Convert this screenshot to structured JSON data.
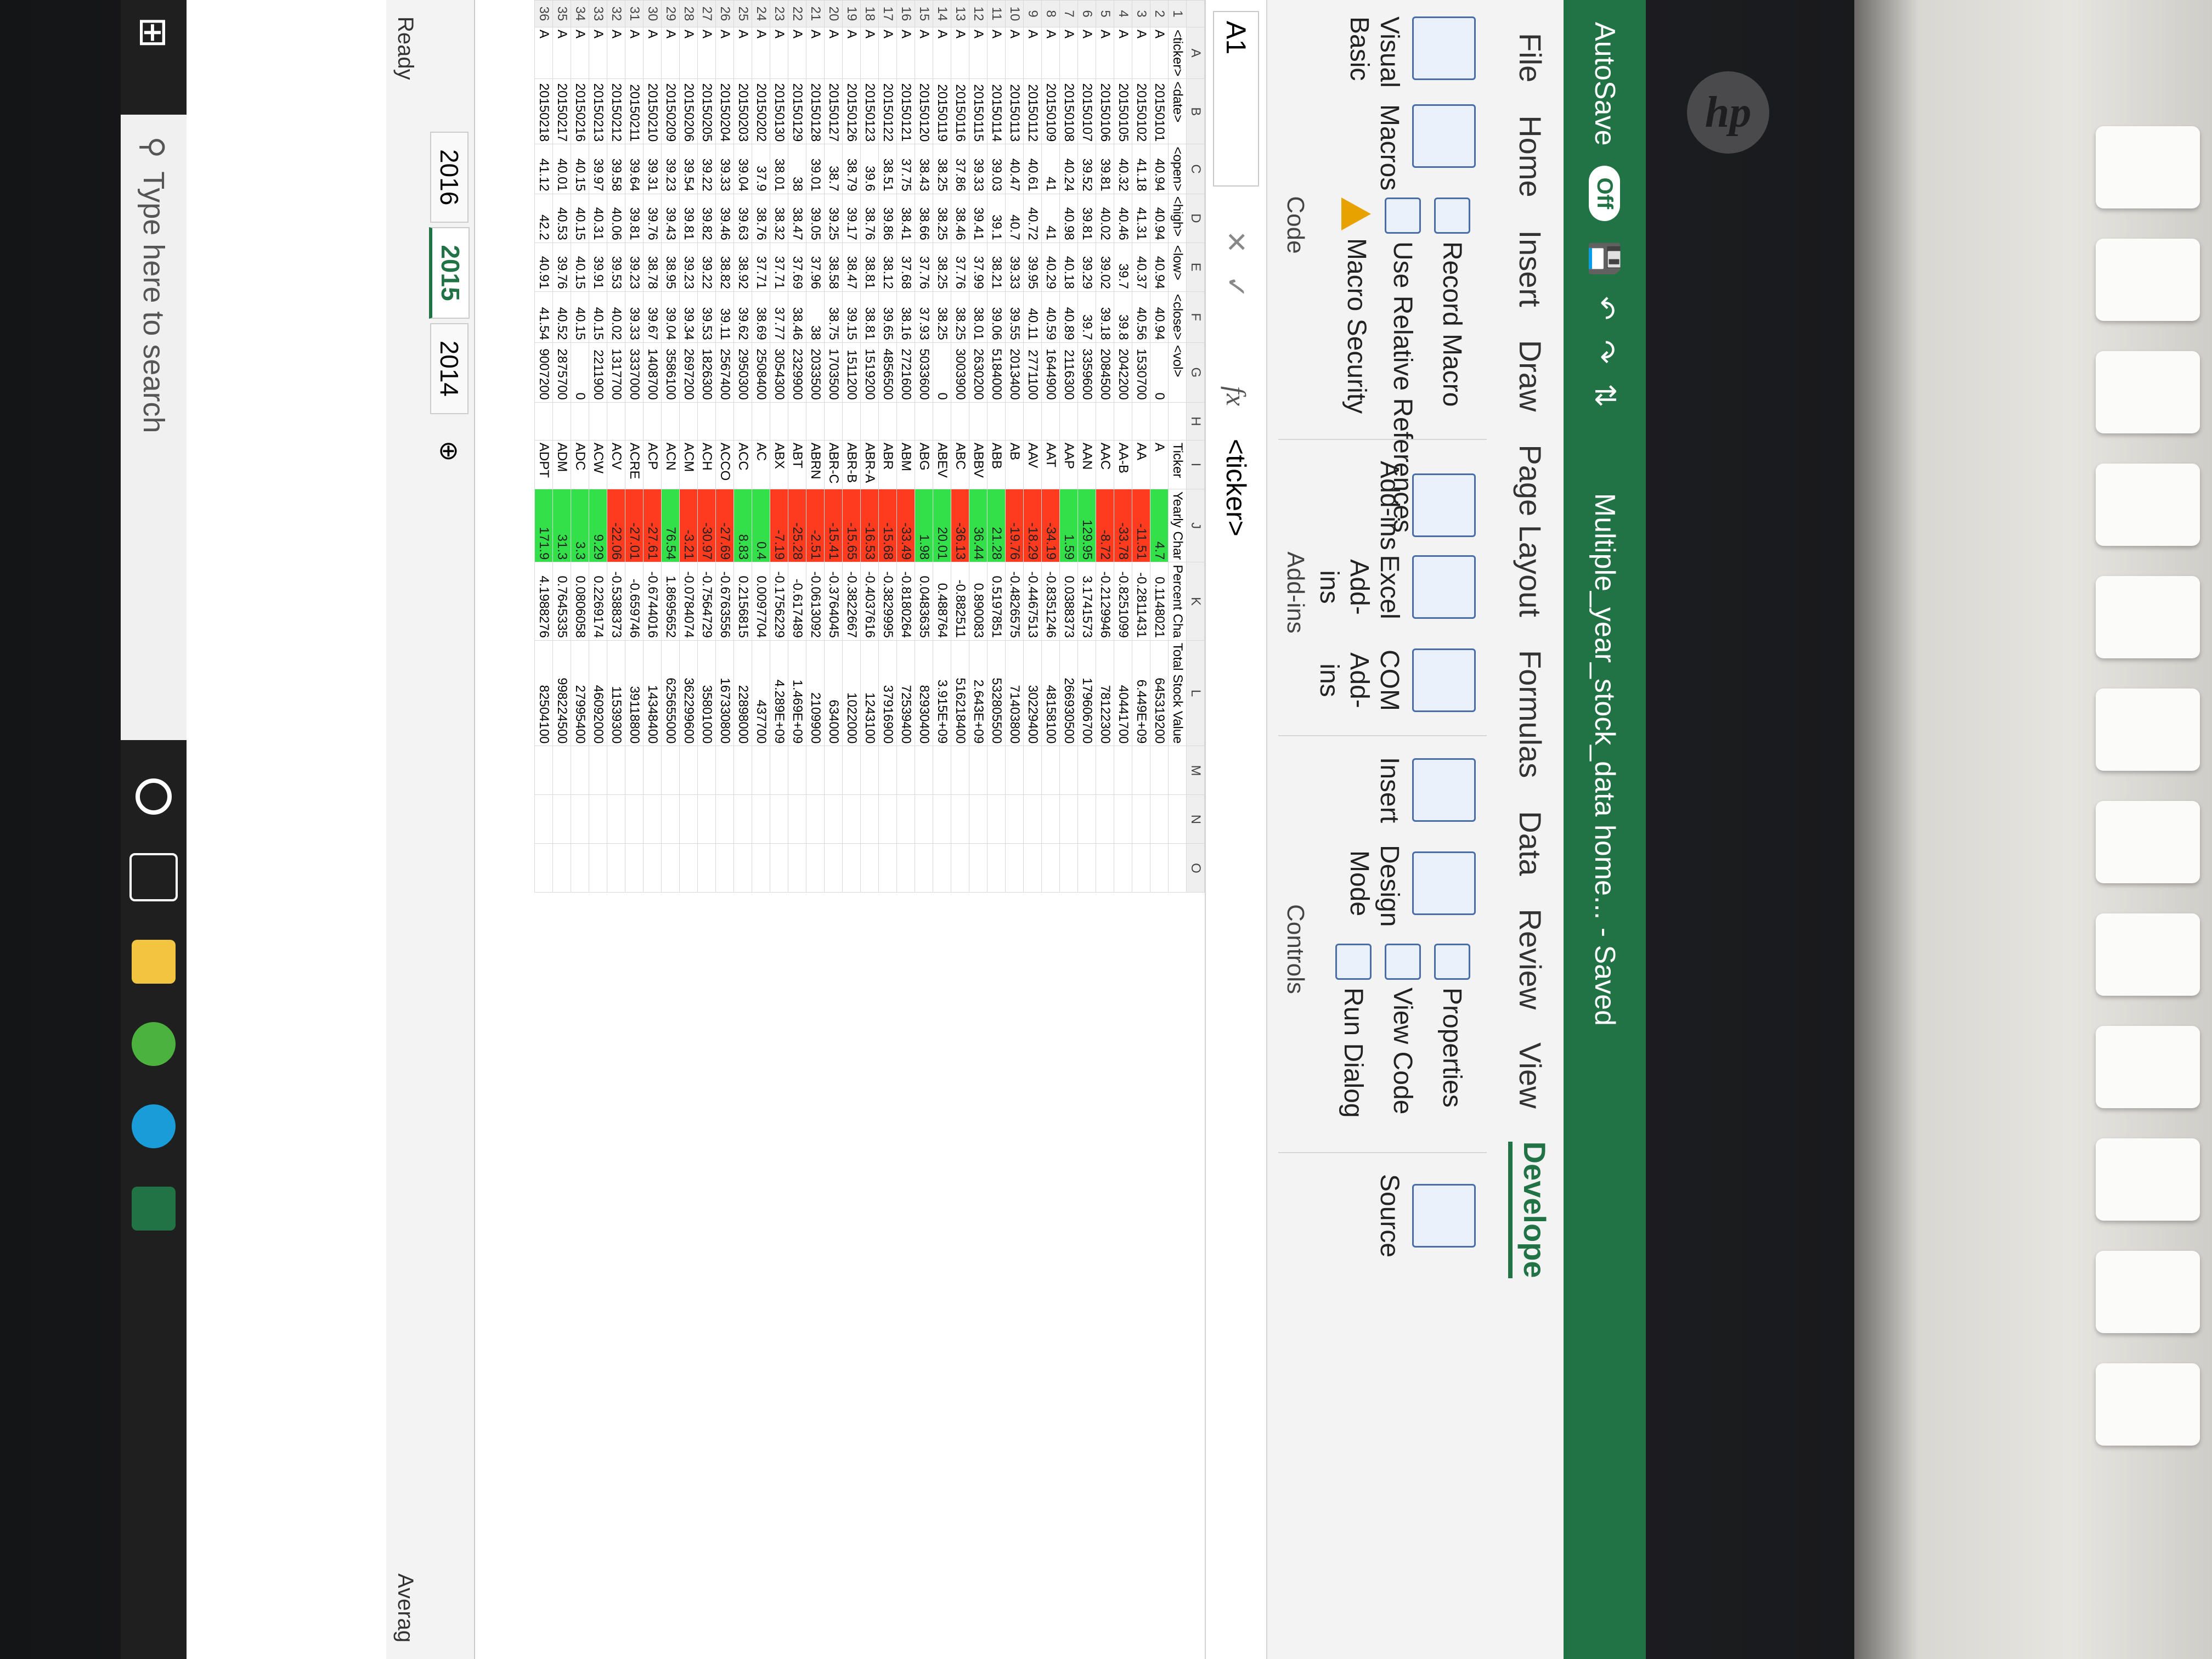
{
  "window": {
    "autosave_label": "AutoSave",
    "autosave_state": "Off",
    "title": "Multiple_year_stock_data home... - Saved"
  },
  "tabs": [
    "File",
    "Home",
    "Insert",
    "Draw",
    "Page Layout",
    "Formulas",
    "Data",
    "Review",
    "View",
    "Develope"
  ],
  "active_tab": "Develope",
  "ribbon": {
    "code": {
      "visual_basic": "Visual Basic",
      "macros": "Macros",
      "record_macro": "Record Macro",
      "use_relative": "Use Relative References",
      "macro_security": "Macro Security",
      "label": "Code"
    },
    "addins": {
      "add_ins": "Add-ins",
      "excel_add_ins": "Excel Add-ins",
      "com_add_ins": "COM Add-ins",
      "label": "Add-ins"
    },
    "controls": {
      "insert": "Insert",
      "design_mode": "Design Mode",
      "properties": "Properties",
      "view_code": "View Code",
      "run_dialog": "Run Dialog",
      "label": "Controls"
    },
    "xml": {
      "source": "Source"
    }
  },
  "formula_bar": {
    "name_box": "A1",
    "fx": "fx",
    "value": "<ticker>"
  },
  "columns": [
    "A",
    "B",
    "C",
    "D",
    "E",
    "F",
    "G",
    "H",
    "I",
    "J",
    "K",
    "L",
    "M",
    "N",
    "O"
  ],
  "left_headers": [
    "<ticker>",
    "<date>",
    "<open>",
    "<high>",
    "<low>",
    "<close>",
    "<vol>"
  ],
  "left_rows": [
    [
      "A",
      "20150101",
      "40.94",
      "40.94",
      "40.94",
      "40.94",
      "0"
    ],
    [
      "A",
      "20150102",
      "41.18",
      "41.31",
      "40.37",
      "40.56",
      "1530700"
    ],
    [
      "A",
      "20150105",
      "40.32",
      "40.46",
      "39.7",
      "39.8",
      "2042200"
    ],
    [
      "A",
      "20150106",
      "39.81",
      "40.02",
      "39.02",
      "39.18",
      "2084500"
    ],
    [
      "A",
      "20150107",
      "39.52",
      "39.81",
      "39.29",
      "39.7",
      "3359600"
    ],
    [
      "A",
      "20150108",
      "40.24",
      "40.98",
      "40.18",
      "40.89",
      "2116300"
    ],
    [
      "A",
      "20150109",
      "41",
      "41",
      "40.29",
      "40.59",
      "1644900"
    ],
    [
      "A",
      "20150112",
      "40.61",
      "40.72",
      "39.95",
      "40.11",
      "2771100"
    ],
    [
      "A",
      "20150113",
      "40.47",
      "40.7",
      "39.33",
      "39.55",
      "2013400"
    ],
    [
      "A",
      "20150114",
      "39.03",
      "39.1",
      "38.21",
      "39.06",
      "5184000"
    ],
    [
      "A",
      "20150115",
      "39.33",
      "39.41",
      "37.99",
      "38.01",
      "2630200"
    ],
    [
      "A",
      "20150116",
      "37.86",
      "38.46",
      "37.76",
      "38.25",
      "3003900"
    ],
    [
      "A",
      "20150119",
      "38.25",
      "38.25",
      "38.25",
      "38.25",
      "0"
    ],
    [
      "A",
      "20150120",
      "38.43",
      "38.66",
      "37.76",
      "37.93",
      "5033600"
    ],
    [
      "A",
      "20150121",
      "37.75",
      "38.41",
      "37.68",
      "38.16",
      "2721600"
    ],
    [
      "A",
      "20150122",
      "38.51",
      "39.86",
      "38.12",
      "39.65",
      "4856500"
    ],
    [
      "A",
      "20150123",
      "39.6",
      "38.76",
      "38.81",
      "38.81",
      "1519200"
    ],
    [
      "A",
      "20150126",
      "38.79",
      "39.17",
      "38.47",
      "39.15",
      "1511200"
    ],
    [
      "A",
      "20150127",
      "38.7",
      "39.25",
      "38.58",
      "38.75",
      "1703500"
    ],
    [
      "A",
      "20150128",
      "39.01",
      "39.05",
      "37.96",
      "38",
      "2033500"
    ],
    [
      "A",
      "20150129",
      "38",
      "38.47",
      "37.69",
      "38.46",
      "2329900"
    ],
    [
      "A",
      "20150130",
      "38.01",
      "38.32",
      "37.71",
      "37.77",
      "3054300"
    ],
    [
      "A",
      "20150202",
      "37.9",
      "38.76",
      "37.71",
      "38.69",
      "2508400"
    ],
    [
      "A",
      "20150203",
      "39.04",
      "39.63",
      "38.92",
      "39.62",
      "2950300"
    ],
    [
      "A",
      "20150204",
      "39.33",
      "39.46",
      "38.82",
      "39.11",
      "2567400"
    ],
    [
      "A",
      "20150205",
      "39.22",
      "39.82",
      "39.22",
      "39.53",
      "1826300"
    ],
    [
      "A",
      "20150206",
      "39.54",
      "39.81",
      "39.23",
      "39.34",
      "2697200"
    ],
    [
      "A",
      "20150209",
      "39.23",
      "39.43",
      "38.95",
      "39.04",
      "3586100"
    ],
    [
      "A",
      "20150210",
      "39.31",
      "39.76",
      "38.78",
      "39.67",
      "1408700"
    ],
    [
      "A",
      "20150211",
      "39.64",
      "39.81",
      "39.23",
      "39.33",
      "3337000"
    ],
    [
      "A",
      "20150212",
      "39.58",
      "40.06",
      "39.53",
      "40.02",
      "1317700"
    ],
    [
      "A",
      "20150213",
      "39.97",
      "40.31",
      "39.91",
      "40.15",
      "2211900"
    ],
    [
      "A",
      "20150216",
      "40.15",
      "40.15",
      "40.15",
      "40.15",
      "0"
    ],
    [
      "A",
      "20150217",
      "40.01",
      "40.53",
      "39.76",
      "40.52",
      "2875700"
    ],
    [
      "A",
      "20150218",
      "41.12",
      "42.2",
      "40.91",
      "41.54",
      "9007200"
    ]
  ],
  "right_headers": [
    "Ticker",
    "Yearly Char",
    "Percent Cha",
    "Total Stock Value"
  ],
  "right_rows": [
    [
      "A",
      "4.7",
      "0.1148021",
      "645319200",
      "green"
    ],
    [
      "AA",
      "-11.51",
      "-0.2811431",
      "6.449E+09",
      "red"
    ],
    [
      "AA-B",
      "-33.78",
      "-0.8251099",
      "40441700",
      "red"
    ],
    [
      "AAC",
      "-8.72",
      "-0.2129946",
      "78122300",
      "red"
    ],
    [
      "AAN",
      "129.95",
      "3.1741573",
      "179606700",
      "green"
    ],
    [
      "AAP",
      "1.59",
      "0.0388373",
      "266930500",
      "green"
    ],
    [
      "AAT",
      "-34.19",
      "-0.8351246",
      "48158100",
      "red"
    ],
    [
      "AAV",
      "-18.29",
      "-0.4467513",
      "30229400",
      "red"
    ],
    [
      "AB",
      "-19.76",
      "-0.4826575",
      "71403800",
      "red"
    ],
    [
      "ABB",
      "21.28",
      "0.5197851",
      "532805500",
      "green"
    ],
    [
      "ABBV",
      "36.44",
      "0.890083",
      "2.643E+09",
      "green"
    ],
    [
      "ABC",
      "-36.13",
      "-0.882511",
      "516218400",
      "red"
    ],
    [
      "ABEV",
      "20.01",
      "0.488764",
      "3.915E+09",
      "green"
    ],
    [
      "ABG",
      "1.98",
      "0.0483635",
      "82930400",
      "green"
    ],
    [
      "ABM",
      "-33.49",
      "-0.8180264",
      "72539400",
      "red"
    ],
    [
      "ABR",
      "-15.68",
      "-0.3829995",
      "37916900",
      "red"
    ],
    [
      "ABR-A",
      "-16.53",
      "-0.4037616",
      "1243100",
      "red"
    ],
    [
      "ABR-B",
      "-15.65",
      "-0.3822667",
      "1022000",
      "red"
    ],
    [
      "ABR-C",
      "-15.41",
      "-0.3764045",
      "634000",
      "red"
    ],
    [
      "ABRN",
      "-2.51",
      "-0.0613092",
      "2109900",
      "red"
    ],
    [
      "ABT",
      "-25.28",
      "-0.617489",
      "1.469E+09",
      "red"
    ],
    [
      "ABX",
      "-7.19",
      "-0.1756229",
      "4.289E+09",
      "red"
    ],
    [
      "AC",
      "0.4",
      "0.0097704",
      "437700",
      "green"
    ],
    [
      "ACC",
      "8.83",
      "0.2156815",
      "22898000",
      "green"
    ],
    [
      "ACCO",
      "-27.69",
      "-0.6763556",
      "167330800",
      "red"
    ],
    [
      "ACH",
      "-30.97",
      "-0.7564729",
      "35801000",
      "red"
    ],
    [
      "ACM",
      "-3.21",
      "-0.0784074",
      "362299600",
      "red"
    ],
    [
      "ACN",
      "76.54",
      "1.8695652",
      "625655000",
      "green"
    ],
    [
      "ACP",
      "-27.61",
      "-0.6744016",
      "14348400",
      "red"
    ],
    [
      "ACRE",
      "-27.01",
      "-0.659746",
      "39118800",
      "red"
    ],
    [
      "ACV",
      "-22.06",
      "-0.5388373",
      "11539300",
      "red"
    ],
    [
      "ACW",
      "9.29",
      "0.2269174",
      "46092000",
      "green"
    ],
    [
      "ADC",
      "3.3",
      "0.0806058",
      "27995400",
      "green"
    ],
    [
      "ADM",
      "31.3",
      "0.7645335",
      "998224500",
      "green"
    ],
    [
      "ADPT",
      "171.9",
      "4.1988276",
      "82504100",
      "green"
    ]
  ],
  "sheet_tabs": [
    "2016",
    "2015",
    "2014"
  ],
  "active_sheet": "2015",
  "status": {
    "ready": "Ready",
    "average": "Averag"
  },
  "taskbar": {
    "search_placeholder": "Type here to search"
  },
  "colors": {
    "excel_green": "#217346",
    "negative_fill": "#ff3b1f",
    "positive_fill": "#33e04a"
  }
}
